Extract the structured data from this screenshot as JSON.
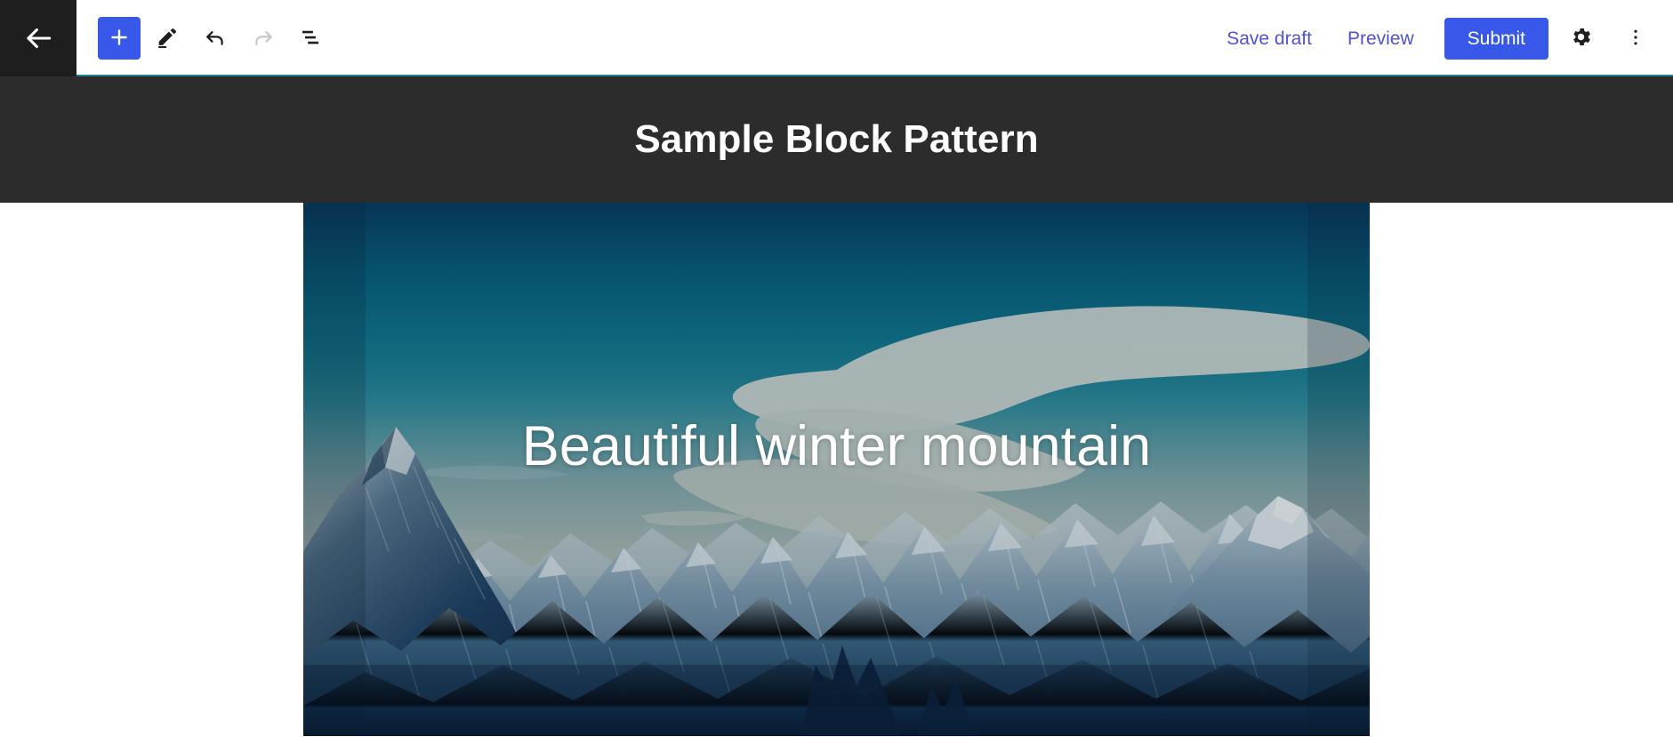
{
  "topbar": {
    "back": {
      "icon": "arrow-left-icon",
      "label": "Back"
    },
    "tools": [
      {
        "name": "add-block-button",
        "icon": "plus-icon",
        "label": "Add block",
        "primary": true,
        "disabled": false
      },
      {
        "name": "edit-tool-button",
        "icon": "pencil-icon",
        "label": "Edit",
        "primary": false,
        "disabled": false
      },
      {
        "name": "undo-button",
        "icon": "undo-arrow-icon",
        "label": "Undo",
        "primary": false,
        "disabled": false
      },
      {
        "name": "redo-button",
        "icon": "redo-arrow-icon",
        "label": "Redo",
        "primary": false,
        "disabled": true
      },
      {
        "name": "list-view-button",
        "icon": "list-view-icon",
        "label": "Document Overview",
        "primary": false,
        "disabled": false
      }
    ],
    "save_draft_label": "Save draft",
    "preview_label": "Preview",
    "submit_label": "Submit",
    "settings": {
      "icon": "gear-icon",
      "label": "Settings"
    },
    "options": {
      "icon": "three-dots-vertical-icon",
      "label": "Options"
    },
    "accent_color": "#3858e9",
    "link_color": "#4f51d6",
    "underline_color": "#1d7e90",
    "back_bg_color": "#1e1e1e"
  },
  "editor": {
    "pattern_title": "Sample Block Pattern",
    "pattern_header_bg": "#2c2c2c",
    "cover": {
      "caption": "Beautiful winter mountain",
      "alt": "Snow covered mountain range under a teal sky with a lenticular cloud",
      "overlay_color": "rgba(18,40,58,0.22)"
    }
  }
}
